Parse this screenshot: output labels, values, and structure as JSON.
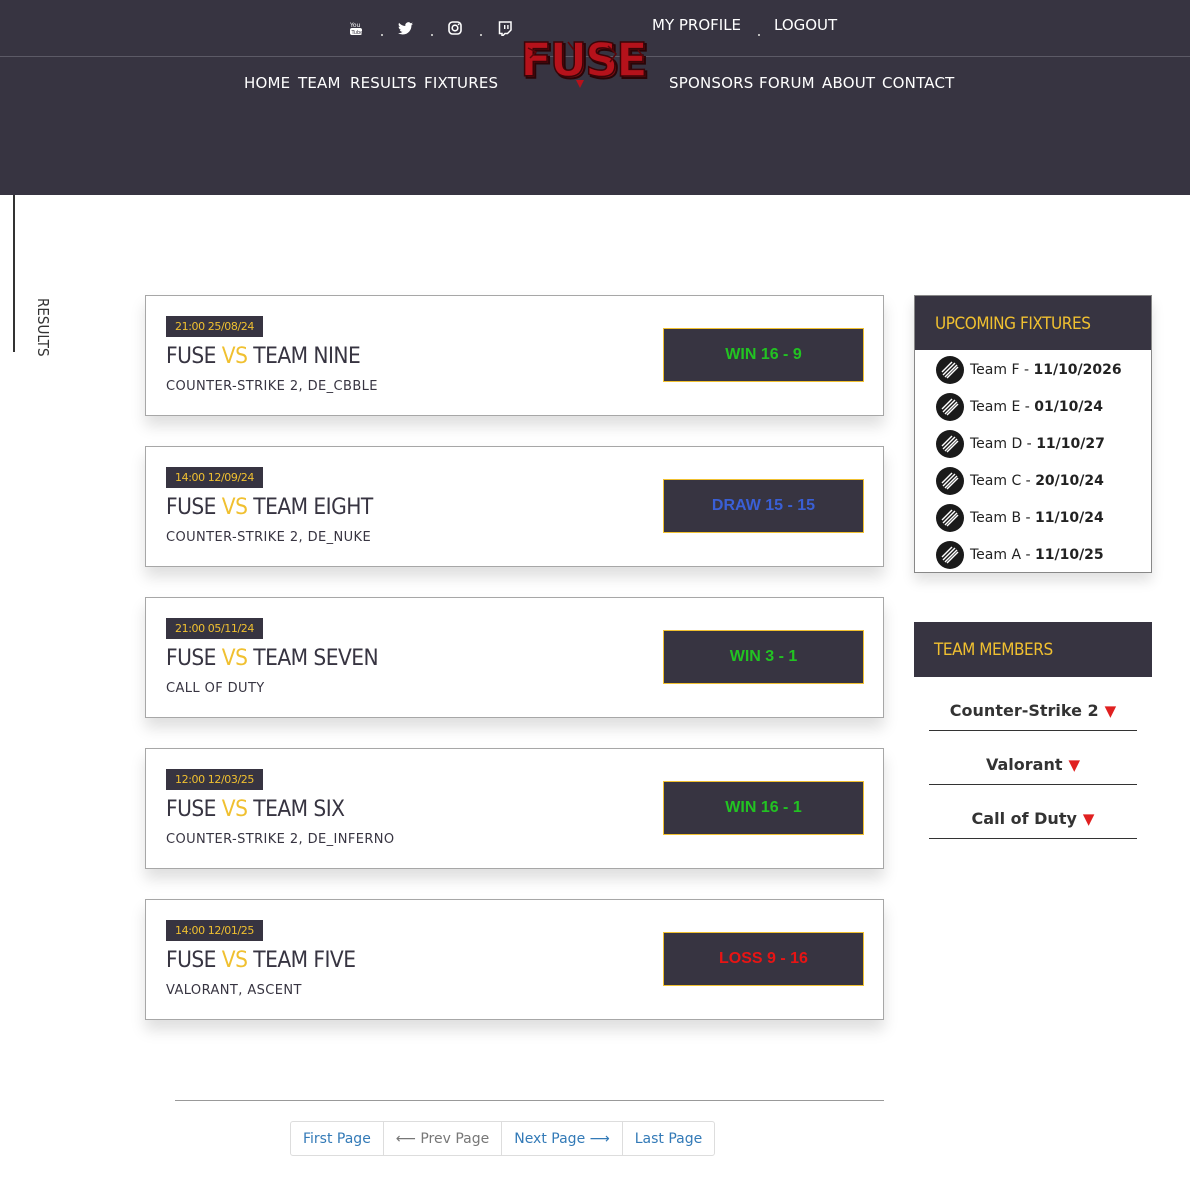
{
  "header": {
    "top_links": {
      "profile": "MY PROFILE",
      "logout": "LOGOUT"
    },
    "nav_left": [
      "HOME",
      "TEAM",
      "RESULTS",
      "FIXTURES"
    ],
    "nav_right": [
      "SPONSORS",
      "FORUM",
      "ABOUT",
      "CONTACT"
    ],
    "logo_text": "FUSE",
    "social_icons": [
      "youtube-icon",
      "twitter-icon",
      "instagram-icon",
      "twitch-icon"
    ]
  },
  "side_label": "RESULTS",
  "results": [
    {
      "datetime": "21:00 25/08/24",
      "team": "FUSE",
      "vs": "VS",
      "opponent": "TEAM NINE",
      "game": "COUNTER-STRIKE 2",
      "map": "DE_CBBLE",
      "score": "WIN 16 - 9",
      "outcome": "win"
    },
    {
      "datetime": "14:00 12/09/24",
      "team": "FUSE",
      "vs": "VS",
      "opponent": "TEAM EIGHT",
      "game": "COUNTER-STRIKE 2",
      "map": "DE_NUKE",
      "score": "DRAW 15 - 15",
      "outcome": "draw"
    },
    {
      "datetime": "21:00 05/11/24",
      "team": "FUSE",
      "vs": "VS",
      "opponent": "TEAM SEVEN",
      "game": "CALL OF DUTY",
      "map": "",
      "score": "WIN 3 - 1",
      "outcome": "win"
    },
    {
      "datetime": "12:00 12/03/25",
      "team": "FUSE",
      "vs": "VS",
      "opponent": "TEAM SIX",
      "game": "COUNTER-STRIKE 2",
      "map": "DE_INFERNO",
      "score": "WIN 16 - 1",
      "outcome": "win"
    },
    {
      "datetime": "14:00 12/01/25",
      "team": "FUSE",
      "vs": "VS",
      "opponent": "TEAM FIVE",
      "game": "VALORANT",
      "map": "ASCENT",
      "score": "LOSS 9 - 16",
      "outcome": "loss"
    }
  ],
  "upcoming": {
    "title": "UPCOMING FIXTURES",
    "items": [
      {
        "team": "Team F",
        "sep": " - ",
        "date": "11/10/2026"
      },
      {
        "team": "Team E",
        "sep": " - ",
        "date": "01/10/24"
      },
      {
        "team": "Team D",
        "sep": " - ",
        "date": "11/10/27"
      },
      {
        "team": "Team C",
        "sep": " - ",
        "date": "20/10/24"
      },
      {
        "team": "Team B",
        "sep": " - ",
        "date": "11/10/24"
      },
      {
        "team": "Team A",
        "sep": " - ",
        "date": "11/10/25"
      }
    ]
  },
  "team_members": {
    "title": "TEAM MEMBERS",
    "arrow": "▼",
    "items": [
      "Counter-Strike 2",
      "Valorant",
      "Call of Duty"
    ]
  },
  "pagination": {
    "first": "First Page",
    "prev": "⟵ Prev Page",
    "next": "Next Page ⟶",
    "last": "Last Page"
  },
  "colors": {
    "dark": "#373441",
    "accent": "#f0c030",
    "win": "#22c322",
    "draw": "#3a5fd6",
    "loss": "#e81414",
    "link": "#337ab7",
    "logo_red": "#b5121b"
  }
}
